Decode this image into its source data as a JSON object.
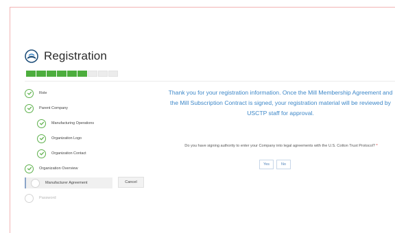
{
  "header": {
    "title": "Registration",
    "logo_icon": "cotton-logo-icon"
  },
  "progress": {
    "total_segments": 9,
    "completed_segments": 6,
    "color": "#4cad3d"
  },
  "steps": [
    {
      "label": "Role",
      "status": "done",
      "level": 0
    },
    {
      "label": "Parent Company",
      "status": "done",
      "level": 0
    },
    {
      "label": "Manufacturing Operations",
      "status": "done",
      "level": 1
    },
    {
      "label": "Organization Logo",
      "status": "done",
      "level": 1
    },
    {
      "label": "Organization Contact",
      "status": "done",
      "level": 1
    },
    {
      "label": "Organization Overview",
      "status": "done",
      "level": 0
    },
    {
      "label": "Manufacturer Agreement",
      "status": "current",
      "level": 0
    },
    {
      "label": "Password",
      "status": "pending",
      "level": 0
    }
  ],
  "actions": {
    "cancel_label": "Cancel"
  },
  "main": {
    "message": "Thank you for your registration information. Once the Mill Membership Agreement and the Mill Subscription Contract is signed, your registration material will be reviewed by USCTP staff for approval.",
    "question": "Do you have signing authority to enter your Company into legal agreements with the U.S. Cotton Trust Protocol?",
    "required_mark": "*",
    "yes_label": "Yes",
    "no_label": "No"
  },
  "colors": {
    "accent_blue": "#3d87c8",
    "check_green": "#5cb04a"
  }
}
